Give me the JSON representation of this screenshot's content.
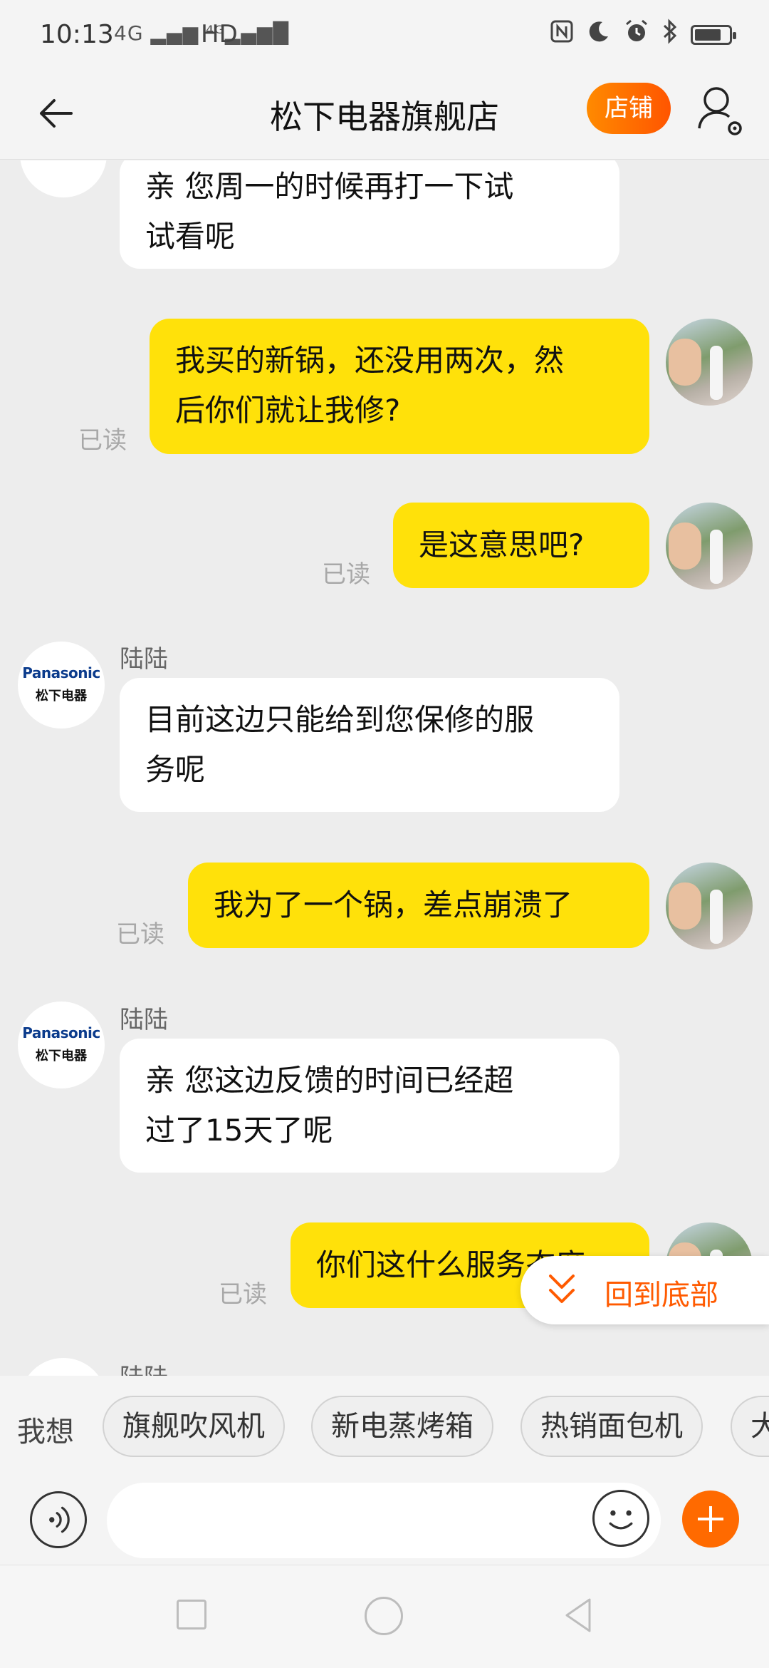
{
  "status_bar": {
    "time": "10:13",
    "network": "4G ▂▄▆ ⁴ᴳ▂▄▆█",
    "hd": "HD",
    "icons": [
      "nfc-icon",
      "moon-icon",
      "alarm-icon",
      "bluetooth-icon",
      "battery-icon"
    ]
  },
  "header": {
    "title": "松下电器旗舰店",
    "shop_button": "店铺",
    "icons": [
      "back-arrow-icon",
      "user-settings-icon"
    ]
  },
  "messages": [
    {
      "side": "left",
      "text_lines": [
        "亲 您周一的时候再打一下试",
        "试看呢"
      ]
    },
    {
      "side": "right",
      "text_lines": [
        "我买的新锅，还没用两次，然",
        "后你们就让我修?"
      ],
      "read": "已读"
    },
    {
      "side": "right",
      "text_lines": [
        "是这意思吧?"
      ],
      "read": "已读"
    },
    {
      "side": "left",
      "sender": "陆陆",
      "text_lines": [
        "目前这边只能给到您保修的服",
        "务呢"
      ]
    },
    {
      "side": "right",
      "text_lines": [
        "我为了一个锅，差点崩溃了"
      ],
      "read": "已读"
    },
    {
      "side": "left",
      "sender": "陆陆",
      "text_lines": [
        "亲 您这边反馈的时间已经超",
        "过了15天了呢"
      ]
    },
    {
      "side": "right",
      "text_lines": [
        "你们这什么服务态度"
      ],
      "read": "已读"
    },
    {
      "side": "left",
      "sender": "陆陆"
    }
  ],
  "shop_avatar": {
    "brand": "Panasonic",
    "brand_cn": "松下电器"
  },
  "scroll_to_bottom": {
    "label": "回到底部",
    "icon": "double-chevron-down-icon"
  },
  "suggestions": {
    "prefix": "我想",
    "chips": [
      "旗舰吹风机",
      "新电蒸烤箱",
      "热销面包机",
      "大"
    ]
  },
  "input": {
    "placeholder": "",
    "icons": [
      "voice-icon",
      "emoji-icon",
      "plus-icon"
    ]
  },
  "nav": {
    "icons": [
      "recent-apps-icon",
      "home-icon",
      "back-icon"
    ]
  },
  "colors": {
    "accent": "#ff6a00",
    "user_bubble": "#ffe10a",
    "shop_bubble": "#ffffff",
    "background": "#ededed"
  }
}
